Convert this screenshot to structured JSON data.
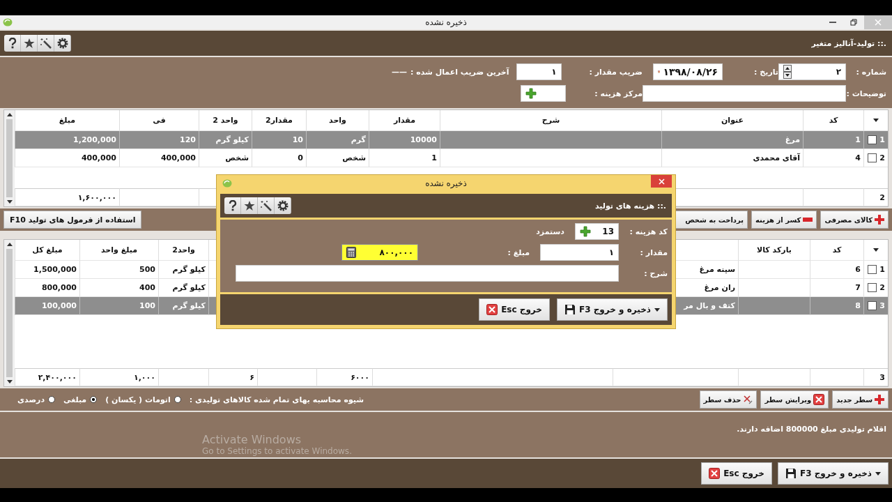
{
  "window": {
    "title": "ذخیره نشده"
  },
  "header": {
    "title": ".:: تولید-آنالیز متغیر"
  },
  "form": {
    "number_label": "شماره :",
    "number": "۲",
    "date_label": "تاریخ :",
    "date": "۱۳۹۸/۰۸/۲۶",
    "multiplier_label": "ضریب مقدار :",
    "multiplier": "۱",
    "last_multiplier_label": "آخرین ضریب اعمال شده :",
    "last_multiplier": "——",
    "notes_label": "توضیحات :",
    "cost_center_label": "مرکز هزینه :"
  },
  "materials_table": {
    "headers": {
      "code": "کد",
      "title": "عنوان",
      "description": "شرح",
      "quantity": "مقدار",
      "unit": "واحد",
      "quantity_2": "مقدار2",
      "unit_2": "واحد 2",
      "price": "فی",
      "amount": "مبلغ"
    },
    "rows": [
      {
        "number": "1",
        "checked": false,
        "selected": true,
        "cells": {
          "code": "1",
          "title": "مرغ",
          "quantity": "10000",
          "unit": "گرم",
          "quantity_2": "10",
          "unit_2": "کیلو گرم",
          "price": "120",
          "amount": "1,200,000"
        }
      },
      {
        "number": "2",
        "checked": false,
        "selected": false,
        "cells": {
          "code": "4",
          "title": "آقای محمدی",
          "quantity": "1",
          "unit": "شخص",
          "quantity_2": "0",
          "unit_2": "شخص",
          "price": "400,000",
          "amount": "400,000"
        }
      }
    ],
    "totals": {
      "number": "2",
      "amount": "۱,۶۰۰,۰۰۰"
    }
  },
  "materials_buttons": [
    {
      "kind": "add",
      "label": "کالای مصرفی"
    },
    {
      "kind": "subtract",
      "label": "کسر از هزینه"
    },
    {
      "kind": "plain",
      "label": "پرداخت به شخص"
    }
  ],
  "formula_button": "استفاده از فرمول های تولید F10",
  "products_table": {
    "headers": {
      "code": "کد",
      "barcode": "بارکد کالا",
      "unit_2": "واحد2",
      "unit_price": "مبلغ واحد",
      "total_amount": "مبلغ کل"
    },
    "rows": [
      {
        "number": "1",
        "checked": false,
        "selected": false,
        "cells": {
          "code": "6",
          "name": "سینه مرغ",
          "unit_2": "کیلو گرم",
          "unit_price": "500",
          "total_amount": "1,500,000"
        }
      },
      {
        "number": "2",
        "checked": false,
        "selected": false,
        "cells": {
          "code": "7",
          "name": "ران مرغ",
          "unit_2": "کیلو گرم",
          "unit_price": "400",
          "total_amount": "800,000"
        }
      },
      {
        "number": "3",
        "checked": false,
        "selected": true,
        "cells": {
          "code": "8",
          "name": "کتف و بال مر",
          "unit_2": "کیلو گرم",
          "unit_price": "100",
          "total_amount": "100,000"
        }
      }
    ],
    "totals": {
      "number": "3",
      "column_6": "۶۰۰۰",
      "column_8": "۶",
      "unit_price": "۱,۰۰۰",
      "total_amount": "۲,۴۰۰,۰۰۰"
    }
  },
  "row_buttons": [
    {
      "kind": "add",
      "label": "سطر جدید"
    },
    {
      "kind": "edit",
      "label": "ویرایش سطر"
    },
    {
      "kind": "delete",
      "label": "حذف سطر"
    }
  ],
  "cost_method": {
    "label": "شیوه محاسبه بهای تمام شده کالاهای تولیدی :",
    "options": [
      {
        "label": "اتومات ( یکسان )",
        "selected": false
      },
      {
        "label": "مبلغی",
        "selected": true
      },
      {
        "label": "درصدی",
        "selected": false
      }
    ]
  },
  "status_message": "اقلام تولیدی مبلغ 800000 اضافه دارند.",
  "os_notice": {
    "title": "Activate Windows",
    "text": "Go to Settings to activate Windows."
  },
  "footer_buttons": [
    {
      "kind": "save",
      "label": "ذخیره و خروج F3"
    },
    {
      "kind": "exit",
      "label": "خروج Esc"
    }
  ],
  "dialog": {
    "title": "ذخیره نشده",
    "header": ".:: هزینه های تولید",
    "cost_code_label": "کد هزینه :",
    "cost_code": "13",
    "cost_name": "دستمزد",
    "quantity_label": "مقدار :",
    "quantity": "۱",
    "amount_label": "مبلغ :",
    "amount": "۸۰۰,۰۰۰",
    "description_label": "شرح :",
    "buttons": [
      {
        "kind": "save",
        "label": "ذخیره و خروج F3"
      },
      {
        "kind": "exit",
        "label": "خروج Esc"
      }
    ]
  }
}
